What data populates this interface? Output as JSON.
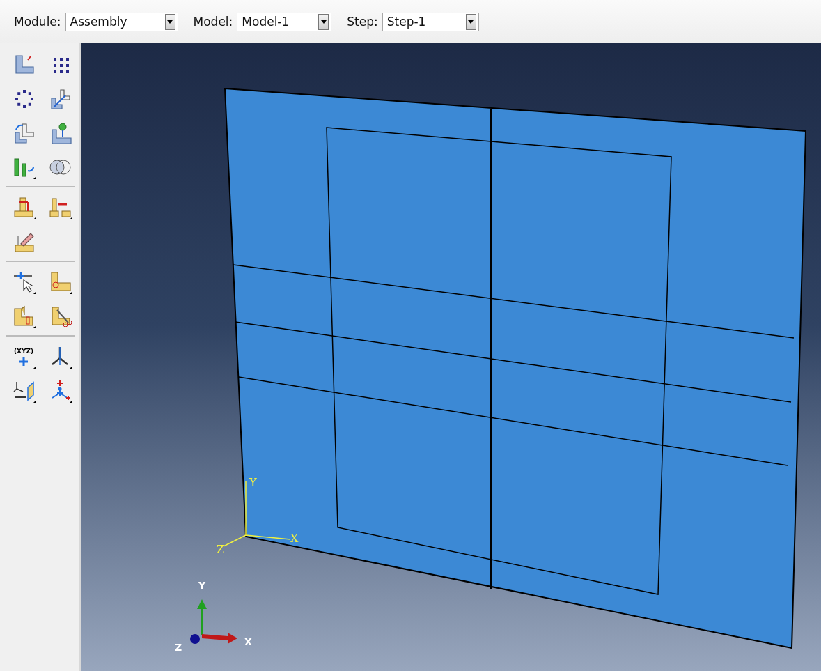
{
  "toolbox": {
    "point_tool_label": "(XYZ)"
  },
  "toolbar": {
    "fields": [
      {
        "label": "Module:",
        "value": "Assembly"
      },
      {
        "label": "Model:",
        "value": "Model-1"
      },
      {
        "label": "Step:",
        "value": "Step-1"
      }
    ]
  },
  "viewport": {
    "local_axes": {
      "x": "X",
      "y": "Y",
      "z": "Z"
    },
    "triad": {
      "x": "X",
      "y": "Y",
      "z": "Z"
    }
  }
}
